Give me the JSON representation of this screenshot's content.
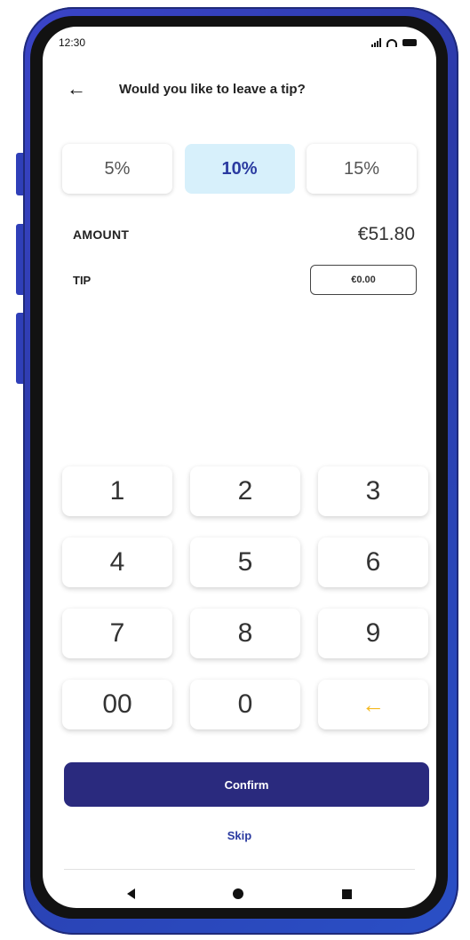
{
  "status_bar": {
    "time": "12:30"
  },
  "header": {
    "back_icon": "←",
    "title": "Would you like to leave a tip?"
  },
  "tip_options": [
    {
      "label": "5%",
      "selected": false
    },
    {
      "label": "10%",
      "selected": true
    },
    {
      "label": "15%",
      "selected": false
    }
  ],
  "summary": {
    "amount_label": "AMOUNT",
    "amount_value": "€51.80",
    "tip_label": "TIP",
    "tip_value": "€0.00"
  },
  "keypad": {
    "keys": [
      "1",
      "2",
      "3",
      "4",
      "5",
      "6",
      "7",
      "8",
      "9",
      "00",
      "0"
    ],
    "backspace_icon": "←"
  },
  "actions": {
    "confirm_label": "Confirm",
    "skip_label": "Skip"
  },
  "colors": {
    "primary": "#2a2a7e",
    "selected_bg": "#d7f0fb",
    "backspace": "#f5b921",
    "frame": "#2f3fb8"
  },
  "icons": {
    "nav_back": "nav-back-icon",
    "nav_home": "nav-home-icon",
    "nav_recent": "nav-recent-icon"
  }
}
